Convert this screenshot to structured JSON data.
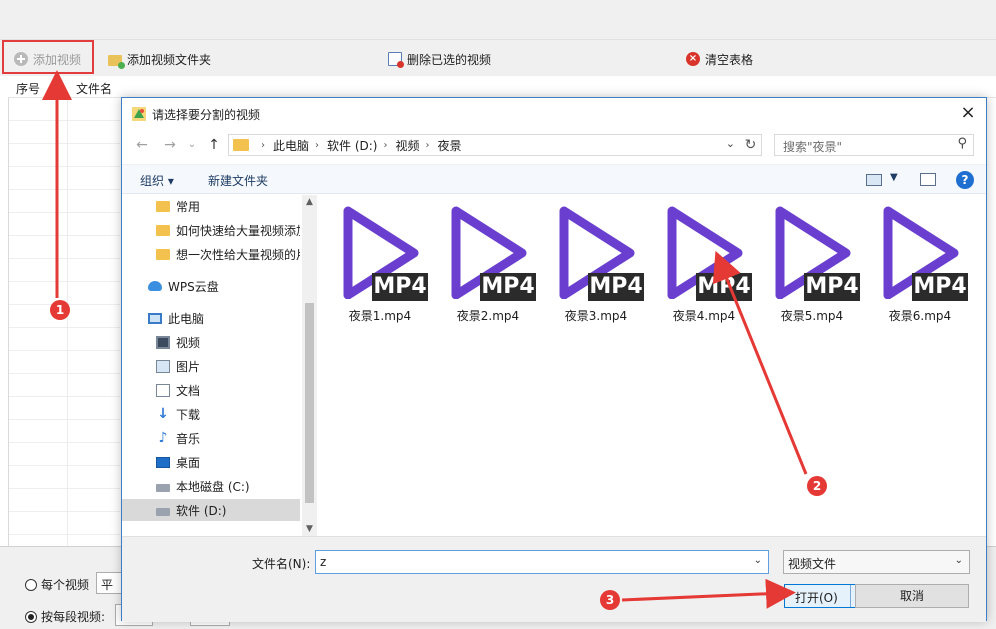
{
  "toolbar": {
    "add_video": "添加视频",
    "add_folder": "添加视频文件夹",
    "delete_selected": "删除已选的视频",
    "clear_table": "清空表格"
  },
  "table": {
    "col_index": "序号",
    "col_filename": "文件名"
  },
  "bottom": {
    "opt_each_video": "每个视频",
    "opt_each_sel_prefix": "平均",
    "opt_by_segment": "按每段视频:"
  },
  "dialog": {
    "title": "请选择要分割的视频",
    "close": "×",
    "address": [
      "此电脑",
      "软件 (D:)",
      "视频",
      "夜景"
    ],
    "search_placeholder": "搜索\"夜景\"",
    "organize": "组织 ▾",
    "new_folder": "新建文件夹",
    "help": "?",
    "nav_items": [
      {
        "label": "常用",
        "icon": "folder-icon"
      },
      {
        "label": "如何快速给大量视频添加",
        "icon": "folder-icon"
      },
      {
        "label": "想一次性给大量视频的片",
        "icon": "folder-icon"
      },
      {
        "label": "WPS云盘",
        "icon": "cloud-icon"
      },
      {
        "label": "此电脑",
        "icon": "computer-icon"
      },
      {
        "label": "视频",
        "icon": "video-folder-icon"
      },
      {
        "label": "图片",
        "icon": "pictures-icon"
      },
      {
        "label": "文档",
        "icon": "documents-icon"
      },
      {
        "label": "下载",
        "icon": "download-icon"
      },
      {
        "label": "音乐",
        "icon": "music-icon"
      },
      {
        "label": "桌面",
        "icon": "desktop-icon"
      },
      {
        "label": "本地磁盘 (C:)",
        "icon": "disk-icon"
      },
      {
        "label": "软件 (D:)",
        "icon": "disk-icon"
      }
    ],
    "files": [
      {
        "name": "夜景1.mp4",
        "badge": "MP4"
      },
      {
        "name": "夜景2.mp4",
        "badge": "MP4"
      },
      {
        "name": "夜景3.mp4",
        "badge": "MP4"
      },
      {
        "name": "夜景4.mp4",
        "badge": "MP4"
      },
      {
        "name": "夜景5.mp4",
        "badge": "MP4"
      },
      {
        "name": "夜景6.mp4",
        "badge": "MP4"
      }
    ],
    "filename_label": "文件名(N):",
    "filename_value": "z",
    "filetype": "视频文件",
    "open": "打开(O)",
    "cancel": "取消"
  },
  "annotations": {
    "step1": "1",
    "step2": "2",
    "step3": "3"
  },
  "colors": {
    "accent": "#0078d7",
    "play_icon": "#6a3fd0",
    "annotation_red": "#e53935"
  }
}
